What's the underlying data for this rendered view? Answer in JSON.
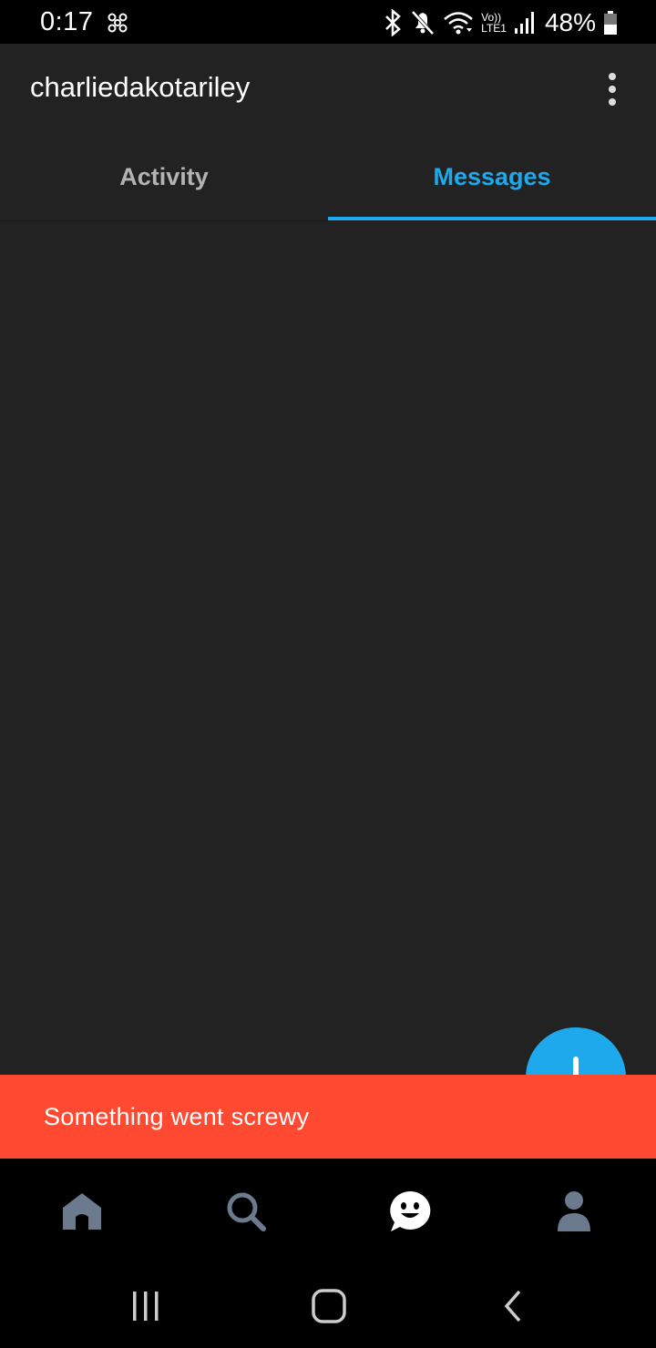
{
  "status_bar": {
    "time": "0:17",
    "left_icon": "pinwheel-notification-icon",
    "icons": [
      "bluetooth-icon",
      "mute-icon",
      "wifi-icon",
      "volte-lte1-icon",
      "signal-icon"
    ],
    "volte_label": "Vo))",
    "lte_label": "LTE1",
    "battery_percent": "48%",
    "battery_level": 0.48
  },
  "app_bar": {
    "account_name": "charliedakotariley",
    "menu_icon": "overflow-menu-icon"
  },
  "tabs": [
    {
      "label": "Activity",
      "selected": false
    },
    {
      "label": "Messages",
      "selected": true
    }
  ],
  "fab": {
    "icon": "add-icon"
  },
  "snackbar": {
    "text": "Something went screwy"
  },
  "bottom_nav": {
    "items": [
      {
        "icon": "home-icon",
        "selected": false
      },
      {
        "icon": "search-icon",
        "selected": false
      },
      {
        "icon": "chat-smiley-icon",
        "selected": true
      },
      {
        "icon": "profile-icon",
        "selected": false
      }
    ]
  },
  "system_nav": {
    "buttons": [
      "recents-icon",
      "home-button-icon",
      "back-icon"
    ]
  },
  "colors": {
    "accent": "#1ea9ec",
    "background": "#222222",
    "snackbar": "#ff4930",
    "nav_inactive": "#6b7a8c"
  }
}
